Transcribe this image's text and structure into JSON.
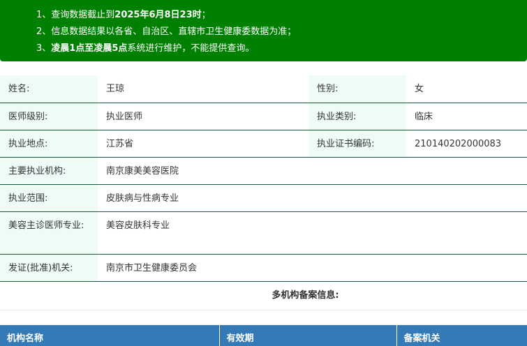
{
  "notice": {
    "line1_prefix": "1、查询数据截止到",
    "line1_bold": "2025年6月8日23时",
    "line1_suffix": "；",
    "line2": "2、信息数据结果以各省、自治区、直辖市卫生健康委数据为准；",
    "line3_prefix": "3、",
    "line3_bold": "凌晨1点至凌晨5点",
    "line3_suffix": "系统进行维护，不能提供查询。"
  },
  "info": {
    "name_label": "姓名:",
    "name_value": "王琼",
    "gender_label": "性别:",
    "gender_value": "女",
    "level_label": "医师级别:",
    "level_value": "执业医师",
    "category_label": "执业类别:",
    "category_value": "临床",
    "location_label": "执业地点:",
    "location_value": "江苏省",
    "cert_label": "执业证书编码:",
    "cert_value": "210140202000083",
    "institution_label": "主要执业机构:",
    "institution_value": "南京康美美容医院",
    "scope_label": "执业范围:",
    "scope_value": "皮肤病与性病专业",
    "cosmetic_label": "美容主诊医师专业:",
    "cosmetic_value": "美容皮肤科专业",
    "issuer_label": "发证(批准)机关:",
    "issuer_value": "南京市卫生健康委员会"
  },
  "multi": {
    "title": "多机构备案信息:",
    "columns": [
      "机构名称",
      "有效期",
      "备案机关"
    ]
  }
}
